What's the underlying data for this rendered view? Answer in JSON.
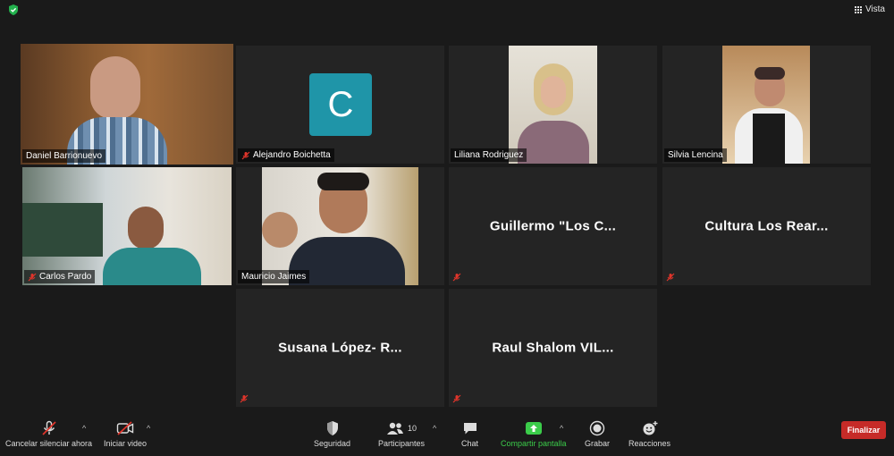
{
  "topbar": {
    "view_label": "Vista"
  },
  "participants": [
    {
      "name": "Daniel Barrionuevo",
      "muted": false,
      "active": true
    },
    {
      "name": "Alejandro Boichetta",
      "muted": true,
      "avatar_letter": "C",
      "avatar_color": "#1f95a8"
    },
    {
      "name": "Liliana Rodriguez",
      "muted": false
    },
    {
      "name": "Silvia Lencina",
      "muted": false
    },
    {
      "name": "Carlos Pardo",
      "muted": true
    },
    {
      "name": "Mauricio Jaimes",
      "muted": false
    },
    {
      "name": "Guillermo \"Los C...",
      "muted": true
    },
    {
      "name": "Cultura Los Rear...",
      "muted": true
    },
    {
      "name": "Susana López- R...",
      "muted": true
    },
    {
      "name": "Raul Shalom VIL...",
      "muted": true
    }
  ],
  "toolbar": {
    "unmute_label": "Cancelar silenciar ahora",
    "video_label": "Iniciar video",
    "security_label": "Seguridad",
    "participants_label": "Participantes",
    "participants_count": "10",
    "chat_label": "Chat",
    "share_label": "Compartir pantalla",
    "record_label": "Grabar",
    "reactions_label": "Reacciones",
    "end_label": "Finalizar"
  },
  "colors": {
    "active_border": "#d2e58e",
    "share_green": "#3bcc4a",
    "end_red": "#c62b28",
    "mute_red": "#e0352b"
  }
}
